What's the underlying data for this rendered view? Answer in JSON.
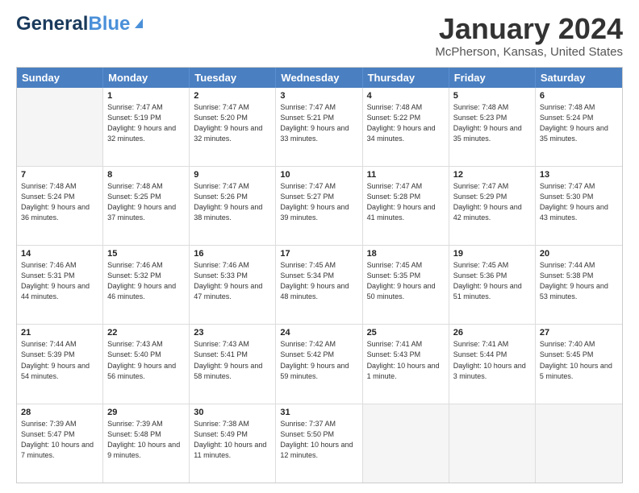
{
  "logo": {
    "line1_dark": "General",
    "line1_blue": "Blue",
    "tagline": ""
  },
  "title": "January 2024",
  "location": "McPherson, Kansas, United States",
  "header_days": [
    "Sunday",
    "Monday",
    "Tuesday",
    "Wednesday",
    "Thursday",
    "Friday",
    "Saturday"
  ],
  "weeks": [
    [
      {
        "day": "",
        "sunrise": "",
        "sunset": "",
        "daylight": "",
        "empty": true
      },
      {
        "day": "1",
        "sunrise": "Sunrise: 7:47 AM",
        "sunset": "Sunset: 5:19 PM",
        "daylight": "Daylight: 9 hours and 32 minutes.",
        "empty": false
      },
      {
        "day": "2",
        "sunrise": "Sunrise: 7:47 AM",
        "sunset": "Sunset: 5:20 PM",
        "daylight": "Daylight: 9 hours and 32 minutes.",
        "empty": false
      },
      {
        "day": "3",
        "sunrise": "Sunrise: 7:47 AM",
        "sunset": "Sunset: 5:21 PM",
        "daylight": "Daylight: 9 hours and 33 minutes.",
        "empty": false
      },
      {
        "day": "4",
        "sunrise": "Sunrise: 7:48 AM",
        "sunset": "Sunset: 5:22 PM",
        "daylight": "Daylight: 9 hours and 34 minutes.",
        "empty": false
      },
      {
        "day": "5",
        "sunrise": "Sunrise: 7:48 AM",
        "sunset": "Sunset: 5:23 PM",
        "daylight": "Daylight: 9 hours and 35 minutes.",
        "empty": false
      },
      {
        "day": "6",
        "sunrise": "Sunrise: 7:48 AM",
        "sunset": "Sunset: 5:24 PM",
        "daylight": "Daylight: 9 hours and 35 minutes.",
        "empty": false
      }
    ],
    [
      {
        "day": "7",
        "sunrise": "Sunrise: 7:48 AM",
        "sunset": "Sunset: 5:24 PM",
        "daylight": "Daylight: 9 hours and 36 minutes.",
        "empty": false
      },
      {
        "day": "8",
        "sunrise": "Sunrise: 7:48 AM",
        "sunset": "Sunset: 5:25 PM",
        "daylight": "Daylight: 9 hours and 37 minutes.",
        "empty": false
      },
      {
        "day": "9",
        "sunrise": "Sunrise: 7:47 AM",
        "sunset": "Sunset: 5:26 PM",
        "daylight": "Daylight: 9 hours and 38 minutes.",
        "empty": false
      },
      {
        "day": "10",
        "sunrise": "Sunrise: 7:47 AM",
        "sunset": "Sunset: 5:27 PM",
        "daylight": "Daylight: 9 hours and 39 minutes.",
        "empty": false
      },
      {
        "day": "11",
        "sunrise": "Sunrise: 7:47 AM",
        "sunset": "Sunset: 5:28 PM",
        "daylight": "Daylight: 9 hours and 41 minutes.",
        "empty": false
      },
      {
        "day": "12",
        "sunrise": "Sunrise: 7:47 AM",
        "sunset": "Sunset: 5:29 PM",
        "daylight": "Daylight: 9 hours and 42 minutes.",
        "empty": false
      },
      {
        "day": "13",
        "sunrise": "Sunrise: 7:47 AM",
        "sunset": "Sunset: 5:30 PM",
        "daylight": "Daylight: 9 hours and 43 minutes.",
        "empty": false
      }
    ],
    [
      {
        "day": "14",
        "sunrise": "Sunrise: 7:46 AM",
        "sunset": "Sunset: 5:31 PM",
        "daylight": "Daylight: 9 hours and 44 minutes.",
        "empty": false
      },
      {
        "day": "15",
        "sunrise": "Sunrise: 7:46 AM",
        "sunset": "Sunset: 5:32 PM",
        "daylight": "Daylight: 9 hours and 46 minutes.",
        "empty": false
      },
      {
        "day": "16",
        "sunrise": "Sunrise: 7:46 AM",
        "sunset": "Sunset: 5:33 PM",
        "daylight": "Daylight: 9 hours and 47 minutes.",
        "empty": false
      },
      {
        "day": "17",
        "sunrise": "Sunrise: 7:45 AM",
        "sunset": "Sunset: 5:34 PM",
        "daylight": "Daylight: 9 hours and 48 minutes.",
        "empty": false
      },
      {
        "day": "18",
        "sunrise": "Sunrise: 7:45 AM",
        "sunset": "Sunset: 5:35 PM",
        "daylight": "Daylight: 9 hours and 50 minutes.",
        "empty": false
      },
      {
        "day": "19",
        "sunrise": "Sunrise: 7:45 AM",
        "sunset": "Sunset: 5:36 PM",
        "daylight": "Daylight: 9 hours and 51 minutes.",
        "empty": false
      },
      {
        "day": "20",
        "sunrise": "Sunrise: 7:44 AM",
        "sunset": "Sunset: 5:38 PM",
        "daylight": "Daylight: 9 hours and 53 minutes.",
        "empty": false
      }
    ],
    [
      {
        "day": "21",
        "sunrise": "Sunrise: 7:44 AM",
        "sunset": "Sunset: 5:39 PM",
        "daylight": "Daylight: 9 hours and 54 minutes.",
        "empty": false
      },
      {
        "day": "22",
        "sunrise": "Sunrise: 7:43 AM",
        "sunset": "Sunset: 5:40 PM",
        "daylight": "Daylight: 9 hours and 56 minutes.",
        "empty": false
      },
      {
        "day": "23",
        "sunrise": "Sunrise: 7:43 AM",
        "sunset": "Sunset: 5:41 PM",
        "daylight": "Daylight: 9 hours and 58 minutes.",
        "empty": false
      },
      {
        "day": "24",
        "sunrise": "Sunrise: 7:42 AM",
        "sunset": "Sunset: 5:42 PM",
        "daylight": "Daylight: 9 hours and 59 minutes.",
        "empty": false
      },
      {
        "day": "25",
        "sunrise": "Sunrise: 7:41 AM",
        "sunset": "Sunset: 5:43 PM",
        "daylight": "Daylight: 10 hours and 1 minute.",
        "empty": false
      },
      {
        "day": "26",
        "sunrise": "Sunrise: 7:41 AM",
        "sunset": "Sunset: 5:44 PM",
        "daylight": "Daylight: 10 hours and 3 minutes.",
        "empty": false
      },
      {
        "day": "27",
        "sunrise": "Sunrise: 7:40 AM",
        "sunset": "Sunset: 5:45 PM",
        "daylight": "Daylight: 10 hours and 5 minutes.",
        "empty": false
      }
    ],
    [
      {
        "day": "28",
        "sunrise": "Sunrise: 7:39 AM",
        "sunset": "Sunset: 5:47 PM",
        "daylight": "Daylight: 10 hours and 7 minutes.",
        "empty": false
      },
      {
        "day": "29",
        "sunrise": "Sunrise: 7:39 AM",
        "sunset": "Sunset: 5:48 PM",
        "daylight": "Daylight: 10 hours and 9 minutes.",
        "empty": false
      },
      {
        "day": "30",
        "sunrise": "Sunrise: 7:38 AM",
        "sunset": "Sunset: 5:49 PM",
        "daylight": "Daylight: 10 hours and 11 minutes.",
        "empty": false
      },
      {
        "day": "31",
        "sunrise": "Sunrise: 7:37 AM",
        "sunset": "Sunset: 5:50 PM",
        "daylight": "Daylight: 10 hours and 12 minutes.",
        "empty": false
      },
      {
        "day": "",
        "sunrise": "",
        "sunset": "",
        "daylight": "",
        "empty": true
      },
      {
        "day": "",
        "sunrise": "",
        "sunset": "",
        "daylight": "",
        "empty": true
      },
      {
        "day": "",
        "sunrise": "",
        "sunset": "",
        "daylight": "",
        "empty": true
      }
    ]
  ]
}
